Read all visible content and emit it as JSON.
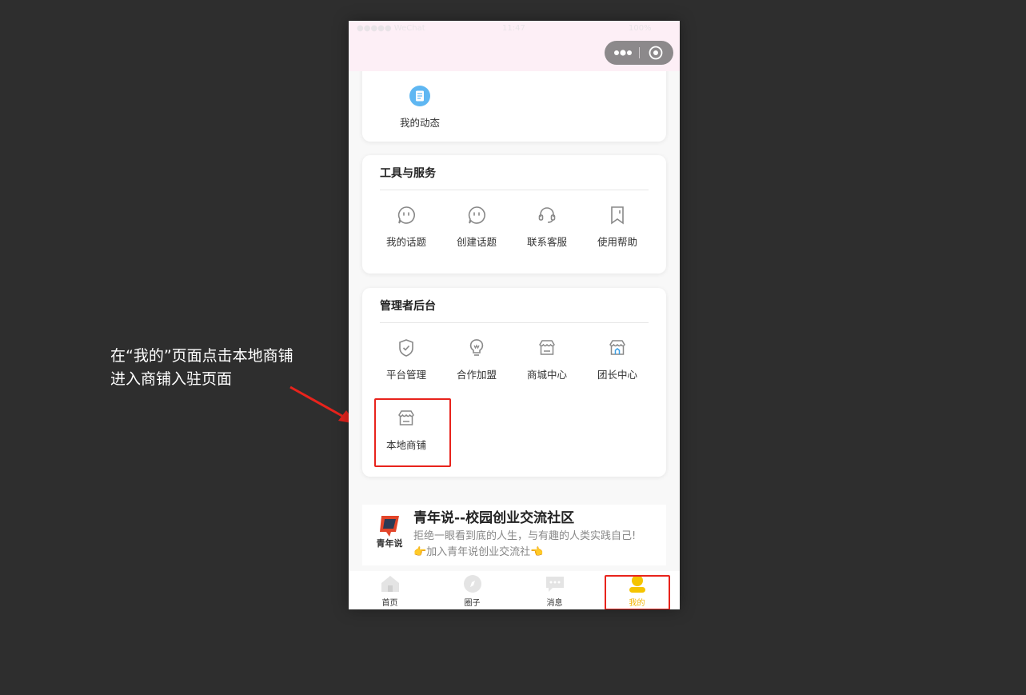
{
  "annotation": {
    "line1": "在“我的”页面点击本地商铺",
    "line2": "进入商铺入驻页面"
  },
  "status_bar": {
    "carrier": "●●●●● WeChat",
    "time": "11:47",
    "battery": "100%"
  },
  "top_card": {
    "item": {
      "label": "我的动态",
      "icon": "document-icon"
    }
  },
  "tools_card": {
    "title": "工具与服务",
    "items": [
      {
        "label": "我的话题",
        "icon": "chat-bubble-icon"
      },
      {
        "label": "创建话题",
        "icon": "chat-bubble-icon"
      },
      {
        "label": "联系客服",
        "icon": "headset-icon"
      },
      {
        "label": "使用帮助",
        "icon": "bookmark-help-icon"
      }
    ]
  },
  "admin_card": {
    "title": "管理者后台",
    "items": [
      {
        "label": "平台管理",
        "icon": "shield-check-icon"
      },
      {
        "label": "合作加盟",
        "icon": "lightbulb-icon"
      },
      {
        "label": "商城中心",
        "icon": "store-icon"
      },
      {
        "label": "团长中心",
        "icon": "store-house-icon"
      },
      {
        "label": "本地商铺",
        "icon": "store-icon"
      }
    ]
  },
  "promo": {
    "logo_text": "青年说",
    "title": "青年说--校园创业交流社区",
    "desc": "拒绝一眼看到底的人生，与有趣的人类实践自己!",
    "desc2": "👉加入青年说创业交流社👈"
  },
  "tabbar": {
    "tabs": [
      {
        "label": "首页",
        "icon": "home-icon"
      },
      {
        "label": "圈子",
        "icon": "compass-icon"
      },
      {
        "label": "消息",
        "icon": "message-icon"
      },
      {
        "label": "我的",
        "icon": "user-icon"
      }
    ],
    "active_index": 3
  },
  "colors": {
    "highlight": "#e8231c",
    "accent": "#f2b400",
    "statusbar_bg": "#fdeff6"
  }
}
